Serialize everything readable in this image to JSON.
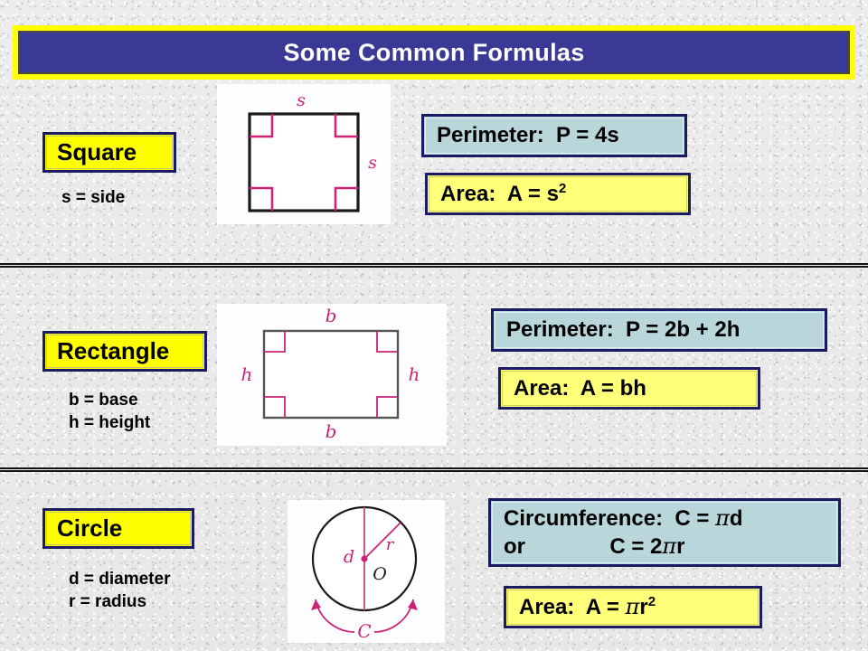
{
  "title": {
    "text": "Some Common Formulas",
    "bar_color": "#3a3a96",
    "border_color": "#ffff00",
    "text_color": "#ffffff"
  },
  "theme": {
    "background": "#eaeaea",
    "label_fill": "#ffff00",
    "label_border": "#1b1b63",
    "perimeter_fill": "#b9d6da",
    "area_fill": "#ffff7a",
    "diagram_mark_color": "#cc2277",
    "diagram_outline_color": "#111111"
  },
  "sections": [
    {
      "name": "square",
      "label": "Square",
      "legend": "s = side",
      "diagram": {
        "shape": "square",
        "side_labels": [
          "s",
          "s"
        ],
        "right_angle_marks": 4
      },
      "formulas": [
        {
          "kind": "perimeter",
          "label": "Perimeter:",
          "expression": "P = 4s",
          "full": "Perimeter:  P = 4s",
          "style": "teal"
        },
        {
          "kind": "area",
          "label": "Area:",
          "expression": "A = s2",
          "full": "Area:  A = s",
          "exponent": "2",
          "style": "yellow"
        }
      ]
    },
    {
      "name": "rectangle",
      "label": "Rectangle",
      "legend": "b = base\nh = height",
      "diagram": {
        "shape": "rectangle",
        "side_labels": [
          "b",
          "h",
          "b",
          "h"
        ],
        "right_angle_marks": 4
      },
      "formulas": [
        {
          "kind": "perimeter",
          "label": "Perimeter:",
          "expression": "P = 2b + 2h",
          "full": "Perimeter:  P = 2b + 2h",
          "style": "teal"
        },
        {
          "kind": "area",
          "label": "Area:",
          "expression": "A = bh",
          "full": "Area:  A = bh",
          "style": "yellow"
        }
      ]
    },
    {
      "name": "circle",
      "label": "Circle",
      "legend": "d = diameter\nr = radius",
      "diagram": {
        "shape": "circle",
        "center_label": "O",
        "diameter_label": "d",
        "radius_label": "r",
        "circumference_label": "C"
      },
      "formulas": [
        {
          "kind": "circumference",
          "label": "Circumference:",
          "line1_prefix": "Circumference:  C = ",
          "line1_pi": "π",
          "line1_suffix": "d",
          "line2_prefix": "or              C = 2",
          "line2_pi": "π",
          "line2_suffix": "r",
          "style": "teal"
        },
        {
          "kind": "area",
          "label": "Area:",
          "prefix": "Area:  A = ",
          "pi": "π",
          "suffix": "r",
          "exponent": "2",
          "style": "yellow"
        }
      ]
    }
  ]
}
